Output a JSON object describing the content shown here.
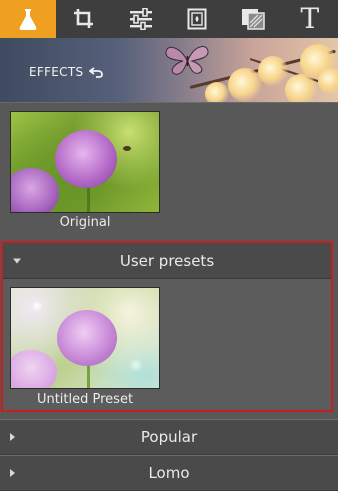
{
  "toolbar": {
    "tools": [
      {
        "name": "effects-flask",
        "active": true
      },
      {
        "name": "crop",
        "active": false
      },
      {
        "name": "adjustments-sliders",
        "active": false
      },
      {
        "name": "frames",
        "active": false
      },
      {
        "name": "textures",
        "active": false
      },
      {
        "name": "text",
        "active": false
      }
    ],
    "text_tool_glyph": "T",
    "accent_color": "#f0a020"
  },
  "header": {
    "title": "EFFECTS",
    "undo_icon": "undo-icon"
  },
  "original": {
    "label": "Original"
  },
  "user_presets": {
    "title": "User presets",
    "expanded": true,
    "items": [
      {
        "label": "Untitled Preset"
      }
    ],
    "highlight_color": "#c81e1e"
  },
  "categories": [
    {
      "label": "Popular",
      "expanded": false
    },
    {
      "label": "Lomo",
      "expanded": false
    }
  ]
}
